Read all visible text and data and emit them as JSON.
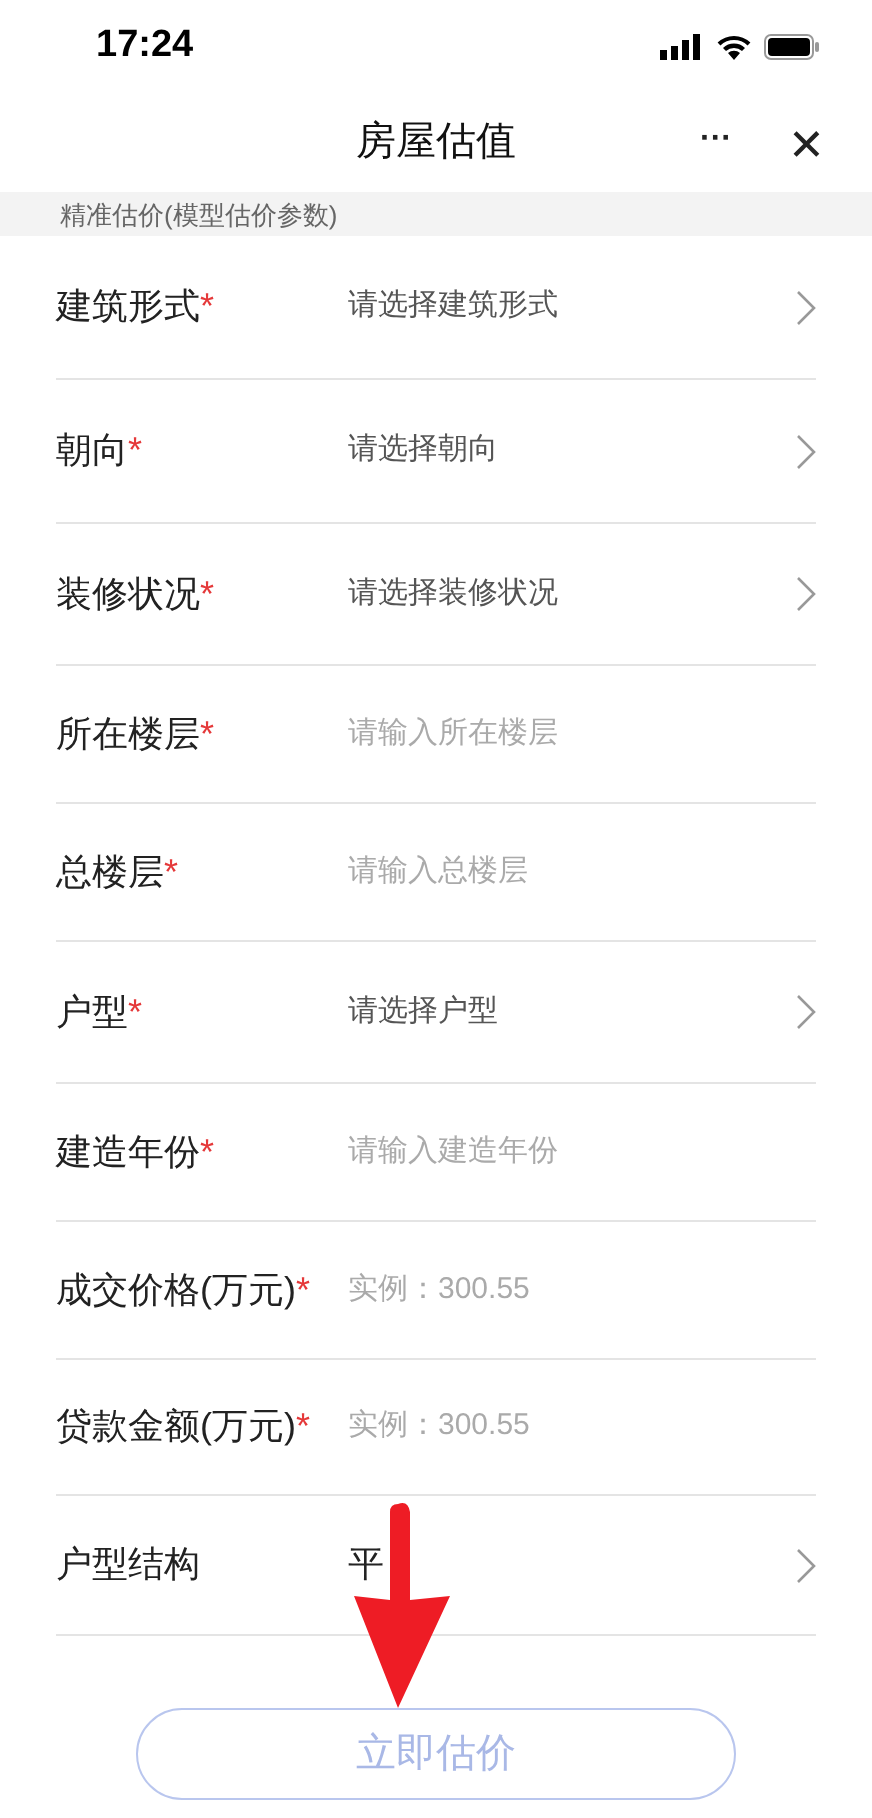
{
  "status_bar": {
    "time": "17:24"
  },
  "header": {
    "title": "房屋估值",
    "more": "···",
    "close": "✕"
  },
  "section_title": "精准估价(模型估价参数)",
  "fields": [
    {
      "label": "建筑形式",
      "required_mark": "*",
      "kind": "select",
      "placeholder": "请选择建筑形式"
    },
    {
      "label": "朝向",
      "required_mark": "*",
      "kind": "select",
      "placeholder": "请选择朝向"
    },
    {
      "label": "装修状况",
      "required_mark": "*",
      "kind": "select",
      "placeholder": "请选择装修状况"
    },
    {
      "label": "所在楼层",
      "required_mark": "*",
      "kind": "input",
      "placeholder": "请输入所在楼层"
    },
    {
      "label": "总楼层",
      "required_mark": "*",
      "kind": "input",
      "placeholder": "请输入总楼层"
    },
    {
      "label": "户型",
      "required_mark": "*",
      "kind": "select",
      "placeholder": "请选择户型"
    },
    {
      "label": "建造年份",
      "required_mark": "*",
      "kind": "input",
      "placeholder": "请输入建造年份"
    },
    {
      "label": "成交价格(万元)",
      "required_mark": "*",
      "kind": "input",
      "placeholder": "实例：300.55"
    },
    {
      "label": "贷款金额(万元)",
      "required_mark": "*",
      "kind": "input",
      "placeholder": "实例：300.55"
    },
    {
      "label": "户型结构",
      "kind": "select",
      "value": "平"
    }
  ],
  "submit_button": "立即估价"
}
